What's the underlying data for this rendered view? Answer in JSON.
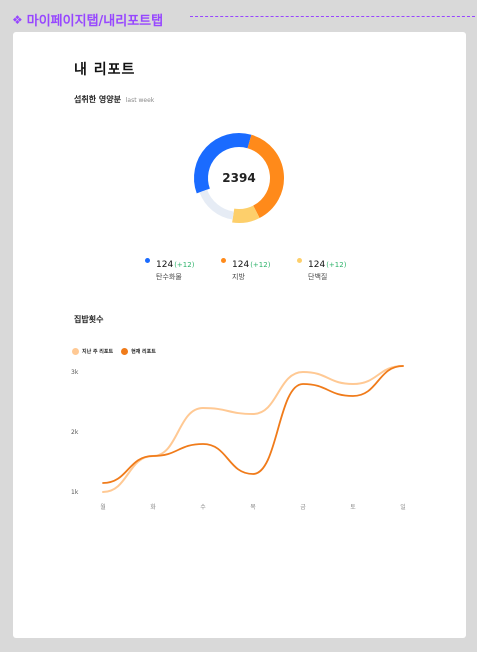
{
  "frame": {
    "label": "마이페이지탭/내리포트탭"
  },
  "report": {
    "title": "내 리포트",
    "nutrient_title": "섭취한 영양분",
    "nutrient_subtitle": "last week",
    "total": "2394",
    "nutrients": [
      {
        "value": "124",
        "delta": "(+12)",
        "name": "탄수화물",
        "color": "#1a6bff"
      },
      {
        "value": "124",
        "delta": "(+12)",
        "name": "지방",
        "color": "#ff8a1a"
      },
      {
        "value": "124",
        "delta": "(+12)",
        "name": "단백질",
        "color": "#fdcf6b"
      }
    ],
    "donut_rest_color": "#e6ecf5",
    "home_meals_title": "집밥횟수"
  },
  "chart_data": {
    "type": "line",
    "categories": [
      "월",
      "화",
      "수",
      "목",
      "금",
      "토",
      "일"
    ],
    "ylim": [
      1000,
      3000
    ],
    "yticks": [
      "1k",
      "2k",
      "3k"
    ],
    "series": [
      {
        "name": "지난 주 리포트",
        "color": "#ffc994",
        "values": [
          1000,
          1600,
          2400,
          2300,
          3000,
          2800,
          3100
        ]
      },
      {
        "name": "현재 리포트",
        "color": "#f07b1a",
        "values": [
          1150,
          1600,
          1800,
          1300,
          2800,
          2600,
          3100
        ]
      }
    ],
    "donut": [
      {
        "label": "탄수화물",
        "fraction": 0.35
      },
      {
        "label": "지방",
        "fraction": 0.38
      },
      {
        "label": "단백질",
        "fraction": 0.1
      },
      {
        "label": "rest",
        "fraction": 0.17
      }
    ]
  }
}
